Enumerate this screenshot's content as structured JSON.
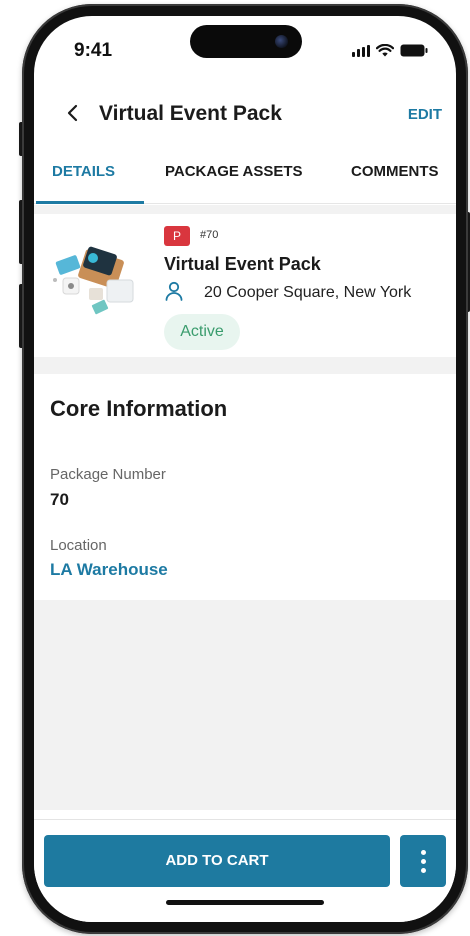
{
  "status_bar": {
    "time": "9:41"
  },
  "header": {
    "title": "Virtual Event Pack",
    "edit_label": "EDIT"
  },
  "tabs": [
    {
      "label": "DETAILS",
      "active": true
    },
    {
      "label": "PACKAGE ASSETS",
      "active": false
    },
    {
      "label": "COMMENTS",
      "active": false
    }
  ],
  "package": {
    "type_badge": "P",
    "number_tag": "#70",
    "name": "Virtual Event Pack",
    "address": "20 Cooper Square, New York",
    "status": "Active"
  },
  "core_information": {
    "title": "Core Information",
    "fields": [
      {
        "label": "Package Number",
        "value": "70"
      },
      {
        "label": "Location",
        "value": "LA Warehouse"
      }
    ]
  },
  "actions": {
    "add_to_cart_label": "ADD TO CART"
  },
  "colors": {
    "accent": "#1d7aa3",
    "badge_red": "#d9363e",
    "status_green": "#3a9c6d",
    "status_green_bg": "#e8f5ef"
  }
}
